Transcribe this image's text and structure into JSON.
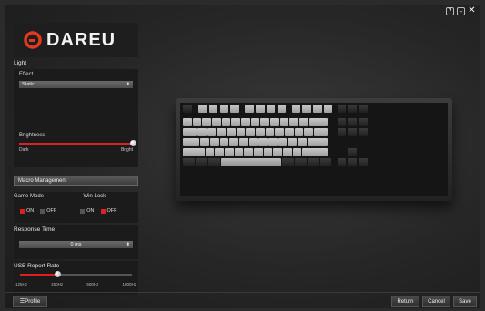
{
  "window_controls": {
    "help": "?",
    "minimize": "–",
    "close": "✕"
  },
  "brand": {
    "name": "DAREU",
    "logo_icon": "dareu-logo-icon"
  },
  "light": {
    "title": "Light",
    "effect_label": "Effect",
    "effect_value": "Static",
    "brightness_label": "Brightness",
    "brightness_min": "Dark",
    "brightness_max": "Bright",
    "brightness_level": 1.0
  },
  "macro": {
    "label": "Macro Management"
  },
  "game_mode": {
    "label": "Game Mode",
    "on": "ON",
    "off": "OFF",
    "selected": "on"
  },
  "win_lock": {
    "label": "Win Lock",
    "on": "ON",
    "off": "OFF",
    "selected": "off"
  },
  "response": {
    "label": "Response Time",
    "value": "0 ms"
  },
  "usb": {
    "label": "USB Report Rate",
    "marks": [
      "125Hz",
      "250Hz",
      "500Hz",
      "1000Hz"
    ],
    "selected_index": 1
  },
  "footer": {
    "profile": "Profile",
    "return": "Return",
    "cancel": "Cancel",
    "save": "Save"
  },
  "colors": {
    "accent": "#e02020",
    "panel": "#1b1b1b"
  }
}
